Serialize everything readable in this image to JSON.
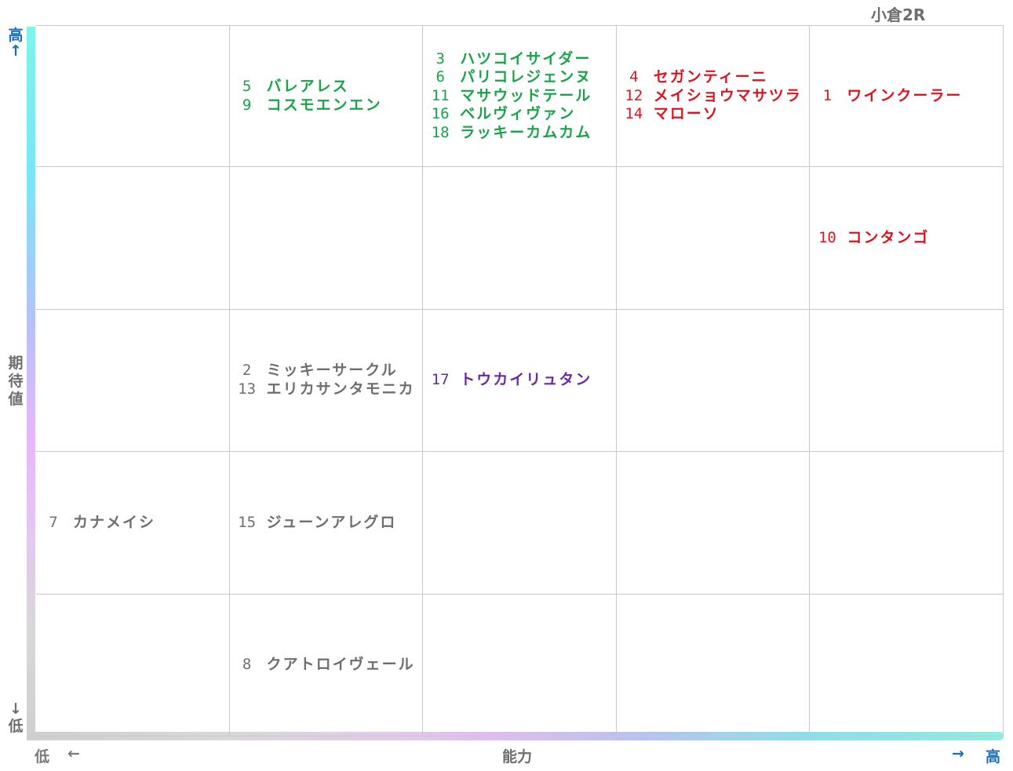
{
  "title": "小倉2R",
  "axes": {
    "y_label": "期待値",
    "y_high": "高",
    "y_high_arrow": "↑",
    "y_low": "低",
    "y_low_arrow": "↓",
    "x_label": "能力",
    "x_low": "低",
    "x_low_arrow": "←",
    "x_high": "高",
    "x_high_arrow": "→"
  },
  "colors": {
    "green": "#1aa34a",
    "red": "#e0121f",
    "purple": "#6a2aa0",
    "gray": "#6e6e6e",
    "axis_blue": "#1a6fb8"
  },
  "grid": {
    "columns": 5,
    "rows": 5,
    "cells": [
      {
        "row": 0,
        "col": 1,
        "color": "green",
        "entries": [
          {
            "num": "5",
            "name": "バレアレス"
          },
          {
            "num": "9",
            "name": "コスモエンエン"
          }
        ]
      },
      {
        "row": 0,
        "col": 2,
        "color": "green",
        "entries": [
          {
            "num": "3",
            "name": "ハツコイサイダー"
          },
          {
            "num": "6",
            "name": "パリコレジェンヌ"
          },
          {
            "num": "11",
            "name": "マサウッドテール"
          },
          {
            "num": "16",
            "name": "ベルヴィヴァン"
          },
          {
            "num": "18",
            "name": "ラッキーカムカム"
          }
        ]
      },
      {
        "row": 0,
        "col": 3,
        "color": "red",
        "entries": [
          {
            "num": "4",
            "name": "セガンティーニ"
          },
          {
            "num": "12",
            "name": "メイショウマサツラ"
          },
          {
            "num": "14",
            "name": "マローソ"
          }
        ]
      },
      {
        "row": 0,
        "col": 4,
        "color": "red",
        "entries": [
          {
            "num": "1",
            "name": "ワインクーラー"
          }
        ]
      },
      {
        "row": 1,
        "col": 4,
        "color": "red",
        "entries": [
          {
            "num": "10",
            "name": "コンタンゴ"
          }
        ]
      },
      {
        "row": 2,
        "col": 1,
        "color": "gray",
        "entries": [
          {
            "num": "2",
            "name": "ミッキーサークル"
          },
          {
            "num": "13",
            "name": "エリカサンタモニカ"
          }
        ]
      },
      {
        "row": 2,
        "col": 2,
        "color": "purple",
        "entries": [
          {
            "num": "17",
            "name": "トウカイリュタン"
          }
        ]
      },
      {
        "row": 3,
        "col": 0,
        "color": "gray",
        "entries": [
          {
            "num": "7",
            "name": "カナメイシ"
          }
        ]
      },
      {
        "row": 3,
        "col": 1,
        "color": "gray",
        "entries": [
          {
            "num": "15",
            "name": "ジューンアレグロ"
          }
        ]
      },
      {
        "row": 4,
        "col": 1,
        "color": "gray",
        "entries": [
          {
            "num": "8",
            "name": "クアトロイヴェール"
          }
        ]
      }
    ]
  }
}
